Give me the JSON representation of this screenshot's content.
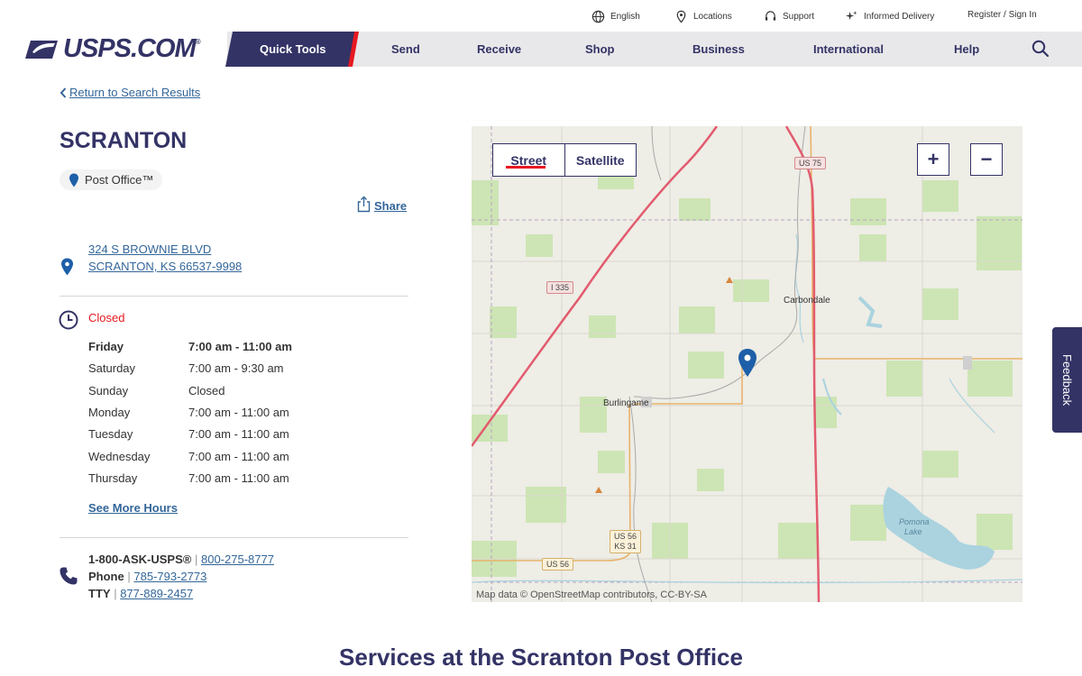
{
  "utility": {
    "english": "English",
    "locations": "Locations",
    "support": "Support",
    "informed_delivery": "Informed Delivery",
    "register": "Register / Sign In"
  },
  "nav": {
    "logo": "USPS.COM",
    "logo_mark": "®",
    "quick_tools": "Quick Tools",
    "send": "Send",
    "receive": "Receive",
    "shop": "Shop",
    "business": "Business",
    "international": "International",
    "help": "Help"
  },
  "back_link": "Return to Search Results",
  "location": {
    "name": "SCRANTON",
    "type": "Post Office™",
    "share": "Share",
    "address_line1": "324 S BROWNIE BLVD",
    "address_line2": "SCRANTON, KS 66537-9998",
    "status": "Closed"
  },
  "hours": [
    {
      "day": "Friday",
      "time": "7:00 am - 11:00 am",
      "today": true
    },
    {
      "day": "Saturday",
      "time": "7:00 am - 9:30 am",
      "today": false
    },
    {
      "day": "Sunday",
      "time": "Closed",
      "today": false
    },
    {
      "day": "Monday",
      "time": "7:00 am - 11:00 am",
      "today": false
    },
    {
      "day": "Tuesday",
      "time": "7:00 am - 11:00 am",
      "today": false
    },
    {
      "day": "Wednesday",
      "time": "7:00 am - 11:00 am",
      "today": false
    },
    {
      "day": "Thursday",
      "time": "7:00 am - 11:00 am",
      "today": false
    }
  ],
  "see_more_hours": "See More Hours",
  "contact": {
    "ask_label": "1-800-ASK-USPS®",
    "ask_number": "800-275-8777",
    "phone_label": "Phone",
    "phone_number": "785-793-2773",
    "tty_label": "TTY",
    "tty_number": "877-889-2457",
    "separator": "|"
  },
  "map": {
    "street": "Street",
    "satellite": "Satellite",
    "zoom_in": "+",
    "zoom_out": "−",
    "attribution": "Map data © OpenStreetMap contributors, CC-BY-SA",
    "places": {
      "carbondale": "Carbondale",
      "burlingame": "Burlingame",
      "pomona_lake_1": "Pomona",
      "pomona_lake_2": "Lake"
    },
    "shields": {
      "us75": "US 75",
      "i335": "I 335",
      "us56_ks31_a": "US 56",
      "us56_ks31_b": "KS 31",
      "us56": "US 56"
    }
  },
  "feedback": "Feedback",
  "services_title": "Services at the Scranton Post Office",
  "colors": {
    "brand_navy": "#333366",
    "brand_red": "#e71921",
    "link_blue": "#336699",
    "pin_blue": "#1d5fa8"
  }
}
